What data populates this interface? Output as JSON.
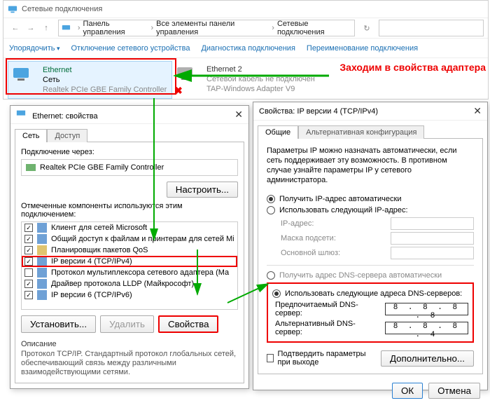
{
  "window": {
    "title": "Сетевые подключения"
  },
  "breadcrumbs": [
    "Панель управления",
    "Все элементы панели управления",
    "Сетевые подключения"
  ],
  "commands": {
    "organize": "Упорядочить",
    "disable": "Отключение сетевого устройства",
    "diagnose": "Диагностика подключения",
    "rename": "Переименование подключения"
  },
  "adapters": {
    "a1": {
      "name": "Ethernet",
      "line2": "Сеть",
      "line3": "Realtek PCIe GBE Family Controller"
    },
    "a2": {
      "name": "Ethernet 2",
      "line2": "Сетевой кабель не подключен",
      "line3": "TAP-Windows Adapter V9"
    }
  },
  "annot": "Заходим в свойства адаптера",
  "ethDlg": {
    "title": "Ethernet: свойства",
    "tabs": {
      "net": "Сеть",
      "access": "Доступ"
    },
    "conn_label": "Подключение через:",
    "conn_device": "Realtek PCIe GBE Family Controller",
    "configure": "Настроить...",
    "components_label": "Отмеченные компоненты используются этим подключением:",
    "comps": {
      "c0": "Клиент для сетей Microsoft",
      "c1": "Общий доступ к файлам и принтерам для сетей Mi",
      "c2": "Планировщик пакетов QoS",
      "c3": "IP версии 4 (TCP/IPv4)",
      "c4": "Протокол мультиплексора сетевого адаптера (Ма",
      "c5": "Драйвер протокола LLDP (Майкрософт)",
      "c6": "IP версии 6 (TCP/IPv6)"
    },
    "install": "Установить...",
    "uninstall": "Удалить",
    "properties": "Свойства",
    "desc_h": "Описание",
    "desc": "Протокол TCP/IP. Стандартный протокол глобальных сетей, обеспечивающий связь между различными взаимодействующими сетями."
  },
  "ipDlg": {
    "title": "Свойства: IP версии 4 (TCP/IPv4)",
    "tabs": {
      "general": "Общие",
      "alt": "Альтернативная конфигурация"
    },
    "intro": "Параметры IP можно назначать автоматически, если сеть поддерживает эту возможность. В противном случае узнайте параметры IP у сетевого администратора.",
    "r_auto_ip": "Получить IP-адрес автоматически",
    "r_manual_ip": "Использовать следующий IP-адрес:",
    "lbl_ip": "IP-адрес:",
    "lbl_mask": "Маска подсети:",
    "lbl_gw": "Основной шлюз:",
    "r_auto_dns": "Получить адрес DNS-сервера автоматически",
    "r_manual_dns": "Использовать следующие адреса DNS-серверов:",
    "lbl_dns1": "Предпочитаемый DNS-сервер:",
    "lbl_dns2": "Альтернативный DNS-сервер:",
    "dns1": "8 . 8 . 8 . 8",
    "dns2": "8 . 8 . 8 . 4",
    "confirm": "Подтвердить параметры при выходе",
    "advanced": "Дополнительно...",
    "ok": "ОК",
    "cancel": "Отмена"
  }
}
